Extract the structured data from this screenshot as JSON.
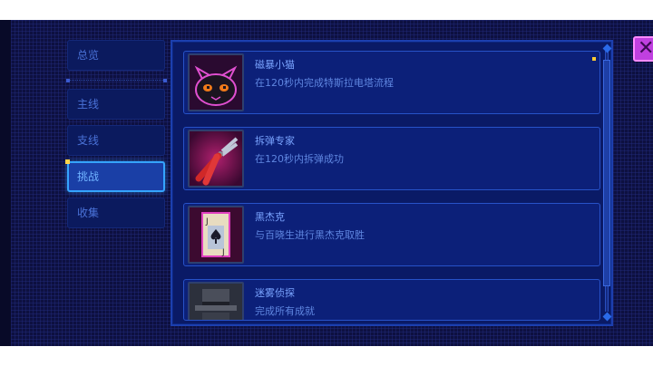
{
  "nav": {
    "items": [
      {
        "label": "总览"
      },
      {
        "label": "主线"
      },
      {
        "label": "支线"
      },
      {
        "label": "挑战",
        "active": true
      },
      {
        "label": "收集"
      }
    ]
  },
  "achievements": [
    {
      "title": "磁暴小猫",
      "desc": "在120秒内完成特斯拉电塔流程",
      "icon": "black-cat-icon",
      "starred": true
    },
    {
      "title": "拆弹专家",
      "desc": "在120秒内拆弹成功",
      "icon": "pliers-icon"
    },
    {
      "title": "黑杰克",
      "desc": "与百晓生进行黑杰克取胜",
      "icon": "playing-card-icon"
    },
    {
      "title": "迷雾侦探",
      "desc": "完成所有成就",
      "icon": "detective-hat-icon"
    }
  ],
  "close_button": {
    "label": "✕"
  },
  "colors": {
    "background": "#0d1040",
    "panel": "#0a1a66",
    "card": "#0c2079",
    "accent": "#35a4ff",
    "close": "#c040e0",
    "star": "#ffcc33"
  }
}
